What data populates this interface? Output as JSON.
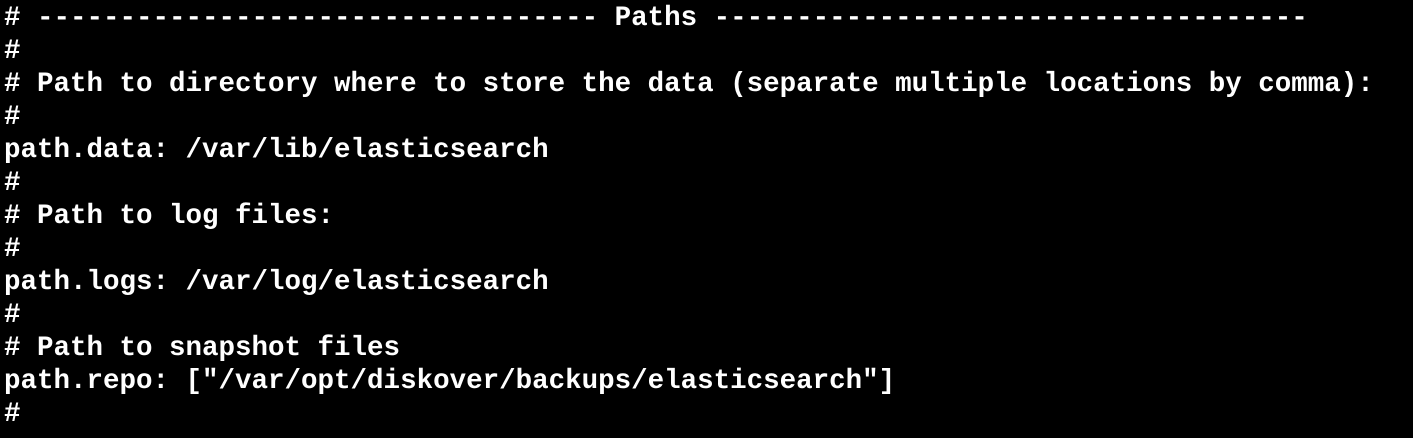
{
  "colors": {
    "background": "#000000",
    "foreground": "#ffffff"
  },
  "lines": [
    "# ---------------------------------- Paths ------------------------------------",
    "#",
    "# Path to directory where to store the data (separate multiple locations by comma):",
    "#",
    "path.data: /var/lib/elasticsearch",
    "#",
    "# Path to log files:",
    "#",
    "path.logs: /var/log/elasticsearch",
    "#",
    "# Path to snapshot files",
    "path.repo: [\"/var/opt/diskover/backups/elasticsearch\"]",
    "#"
  ]
}
